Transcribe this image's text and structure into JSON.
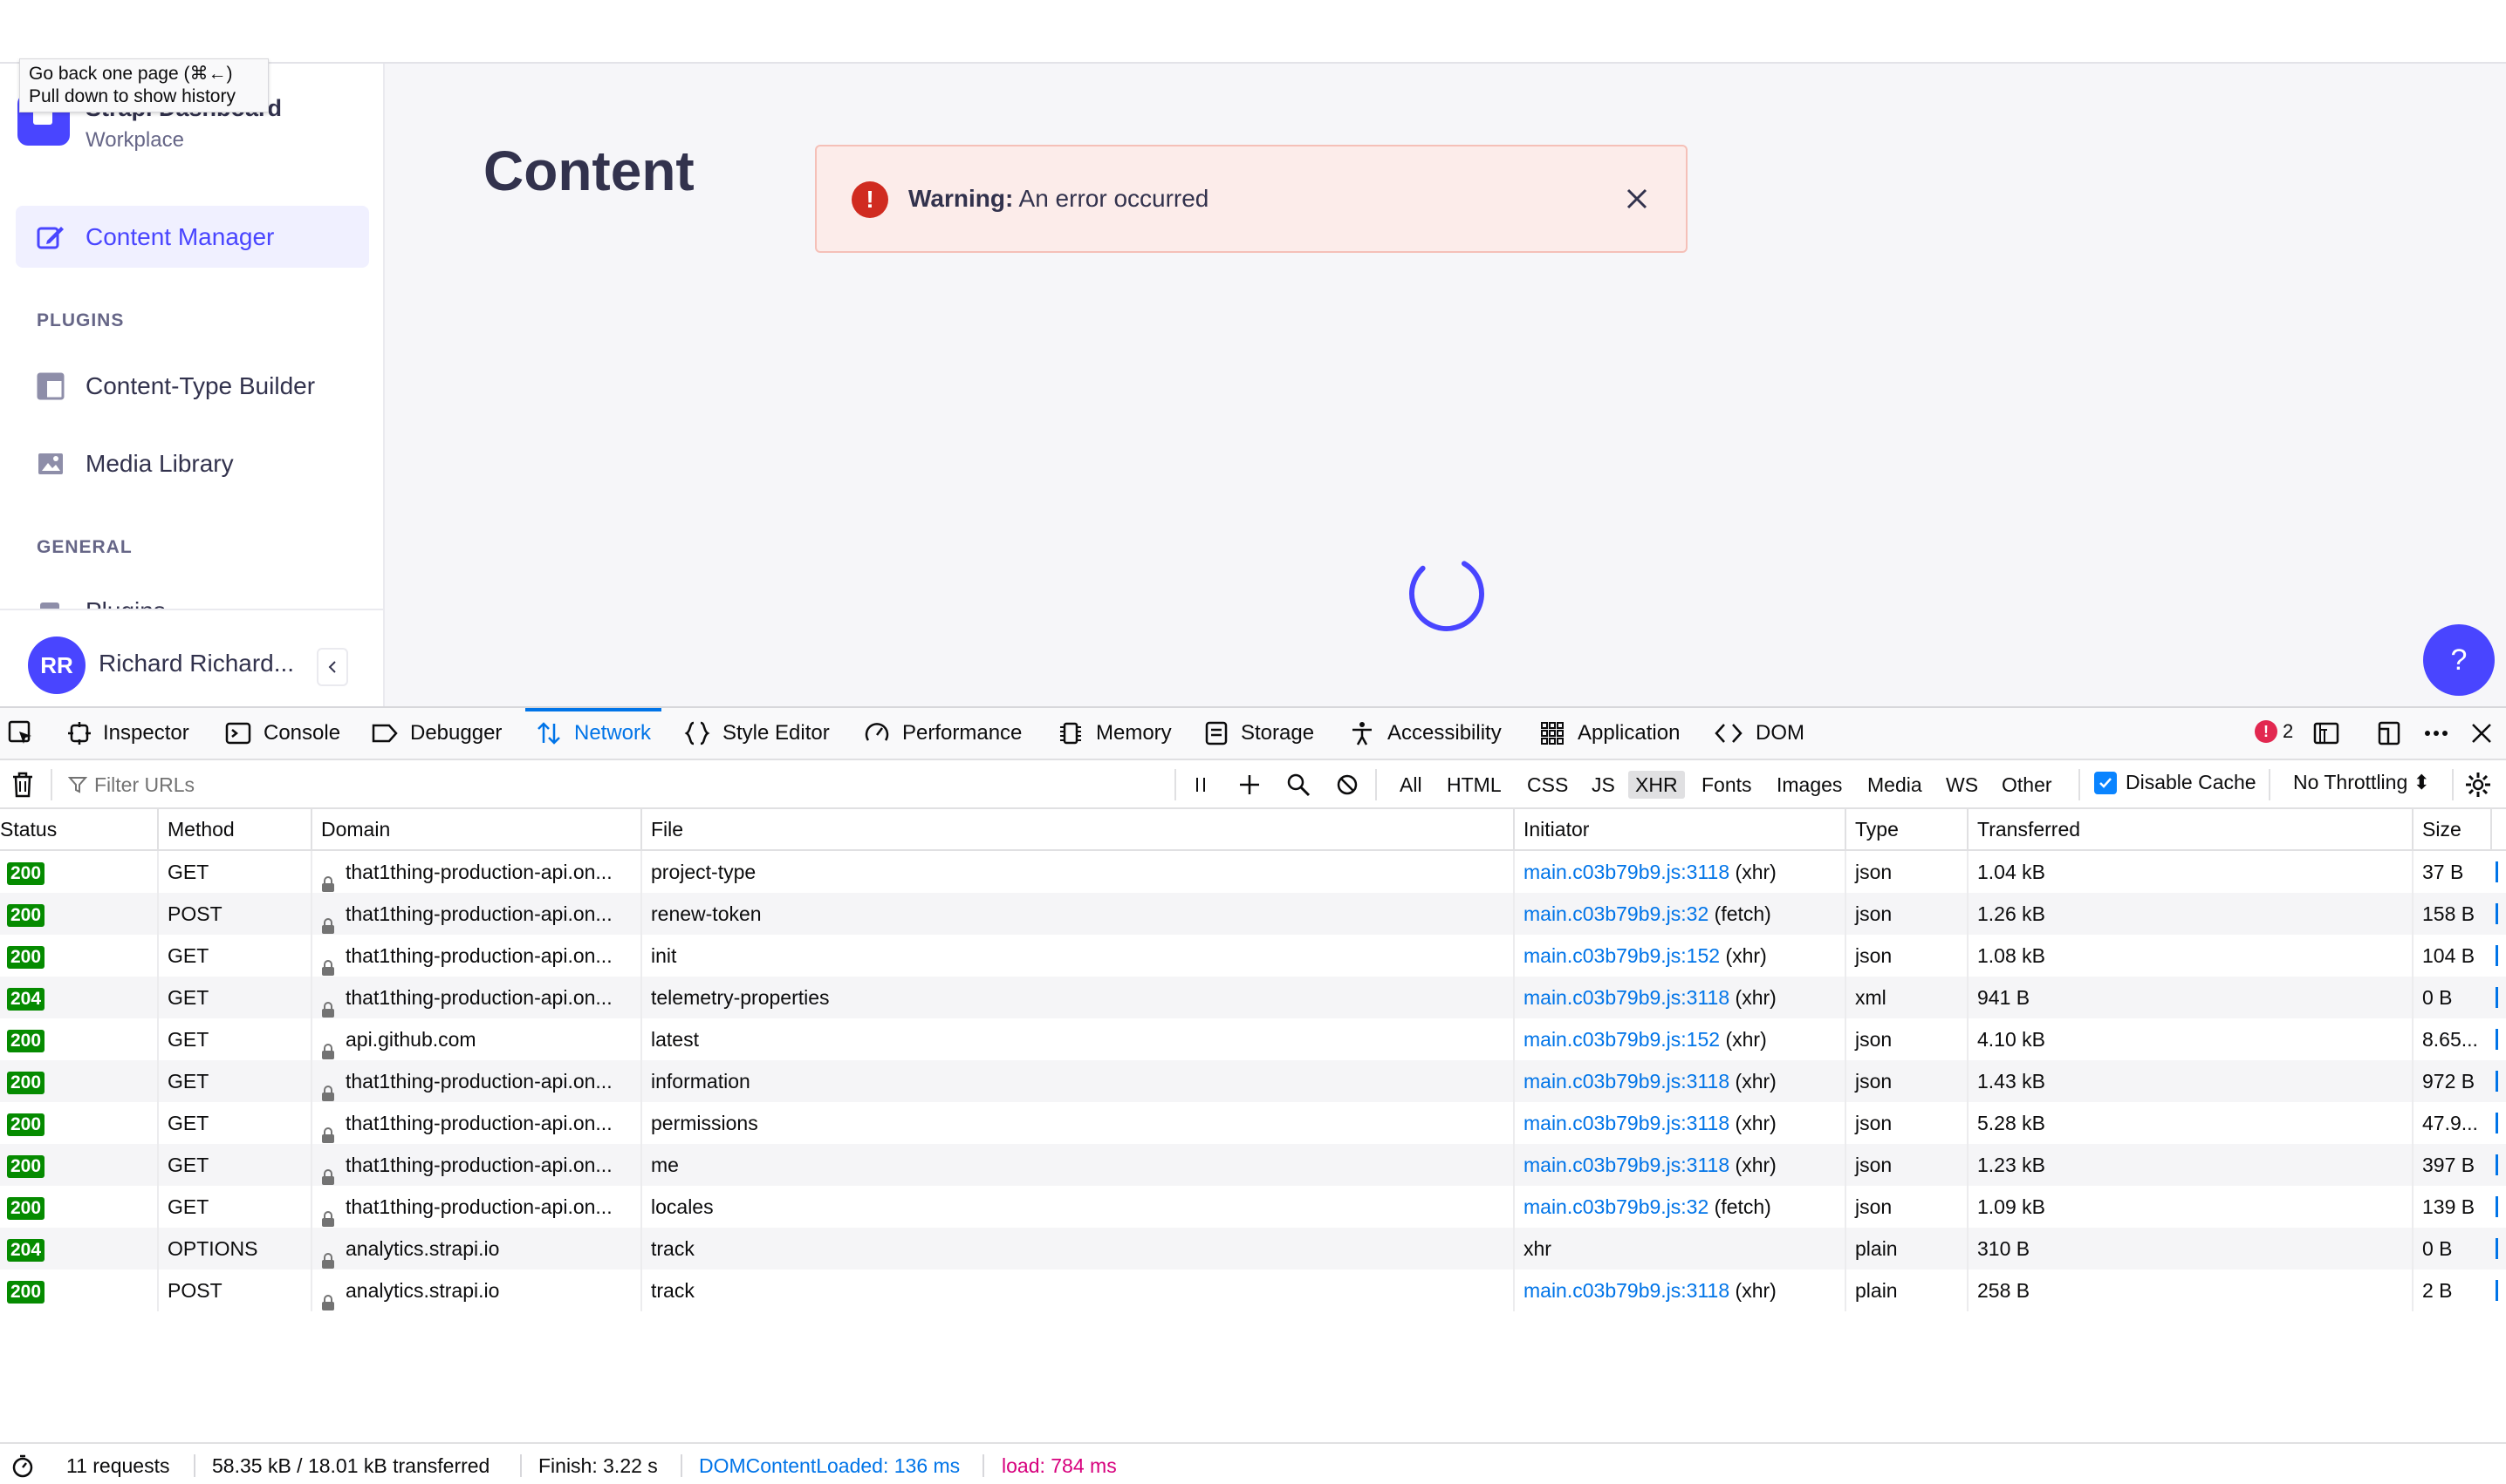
{
  "tooltip": {
    "line1": "Go back one page (⌘←)",
    "line2": "Pull down to show history"
  },
  "app": {
    "brand_title": "Strapi Dashboard",
    "brand_subtitle": "Workplace",
    "nav": {
      "content_manager": "Content Manager",
      "plugins_section": "PLUGINS",
      "content_type_builder": "Content-Type Builder",
      "media_library": "Media Library",
      "general_section": "GENERAL",
      "plugins_item_partial": "Plugins"
    },
    "user": {
      "initials": "RR",
      "name": "Richard Richard..."
    },
    "page_title": "Content",
    "alert": {
      "label": "Warning:",
      "message": "An error occurred"
    },
    "help_label": "?",
    "accent_color": "#4945ff"
  },
  "devtools": {
    "tabs": [
      "Inspector",
      "Console",
      "Debugger",
      "Network",
      "Style Editor",
      "Performance",
      "Memory",
      "Storage",
      "Accessibility",
      "Application",
      "DOM"
    ],
    "active_tab": "Network",
    "error_count": "2",
    "filter_placeholder": "Filter URLs",
    "type_filters": [
      "All",
      "HTML",
      "CSS",
      "JS",
      "XHR",
      "Fonts",
      "Images",
      "Media",
      "WS",
      "Other"
    ],
    "selected_type_filter": "XHR",
    "disable_cache_label": "Disable Cache",
    "disable_cache_checked": true,
    "throttling_label": "No Throttling ⬍",
    "columns": [
      "Status",
      "Method",
      "Domain",
      "File",
      "Initiator",
      "Type",
      "Transferred",
      "Size"
    ],
    "requests": [
      {
        "status": "200",
        "method": "GET",
        "domain": "that1thing-production-api.on...",
        "file": "project-type",
        "initiator_link": "main.c03b79b9.js:3118",
        "initiator_kind": "(xhr)",
        "type": "json",
        "transferred": "1.04 kB",
        "size": "37 B"
      },
      {
        "status": "200",
        "method": "POST",
        "domain": "that1thing-production-api.on...",
        "file": "renew-token",
        "initiator_link": "main.c03b79b9.js:32",
        "initiator_kind": "(fetch)",
        "type": "json",
        "transferred": "1.26 kB",
        "size": "158 B"
      },
      {
        "status": "200",
        "method": "GET",
        "domain": "that1thing-production-api.on...",
        "file": "init",
        "initiator_link": "main.c03b79b9.js:152",
        "initiator_kind": "(xhr)",
        "type": "json",
        "transferred": "1.08 kB",
        "size": "104 B"
      },
      {
        "status": "204",
        "method": "GET",
        "domain": "that1thing-production-api.on...",
        "file": "telemetry-properties",
        "initiator_link": "main.c03b79b9.js:3118",
        "initiator_kind": "(xhr)",
        "type": "xml",
        "transferred": "941 B",
        "size": "0 B"
      },
      {
        "status": "200",
        "method": "GET",
        "domain": "api.github.com",
        "file": "latest",
        "initiator_link": "main.c03b79b9.js:152",
        "initiator_kind": "(xhr)",
        "type": "json",
        "transferred": "4.10 kB",
        "size": "8.65..."
      },
      {
        "status": "200",
        "method": "GET",
        "domain": "that1thing-production-api.on...",
        "file": "information",
        "initiator_link": "main.c03b79b9.js:3118",
        "initiator_kind": "(xhr)",
        "type": "json",
        "transferred": "1.43 kB",
        "size": "972 B"
      },
      {
        "status": "200",
        "method": "GET",
        "domain": "that1thing-production-api.on...",
        "file": "permissions",
        "initiator_link": "main.c03b79b9.js:3118",
        "initiator_kind": "(xhr)",
        "type": "json",
        "transferred": "5.28 kB",
        "size": "47.9..."
      },
      {
        "status": "200",
        "method": "GET",
        "domain": "that1thing-production-api.on...",
        "file": "me",
        "initiator_link": "main.c03b79b9.js:3118",
        "initiator_kind": "(xhr)",
        "type": "json",
        "transferred": "1.23 kB",
        "size": "397 B"
      },
      {
        "status": "200",
        "method": "GET",
        "domain": "that1thing-production-api.on...",
        "file": "locales",
        "initiator_link": "main.c03b79b9.js:32",
        "initiator_kind": "(fetch)",
        "type": "json",
        "transferred": "1.09 kB",
        "size": "139 B"
      },
      {
        "status": "204",
        "method": "OPTIONS",
        "domain": "analytics.strapi.io",
        "file": "track",
        "initiator_link": "",
        "initiator_kind": "xhr",
        "type": "plain",
        "transferred": "310 B",
        "size": "0 B"
      },
      {
        "status": "200",
        "method": "POST",
        "domain": "analytics.strapi.io",
        "file": "track",
        "initiator_link": "main.c03b79b9.js:3118",
        "initiator_kind": "(xhr)",
        "type": "plain",
        "transferred": "258 B",
        "size": "2 B"
      }
    ],
    "summary": {
      "requests": "11 requests",
      "transferred": "58.35 kB / 18.01 kB transferred",
      "finish": "Finish: 3.22 s",
      "dom_content_loaded": "DOMContentLoaded: 136 ms",
      "load": "load: 784 ms"
    },
    "colors": {
      "status_ok": "#058b00",
      "link": "#0074e8",
      "dcl": "#0074e8",
      "load": "#d7007d",
      "error_badge": "#e22850"
    }
  }
}
